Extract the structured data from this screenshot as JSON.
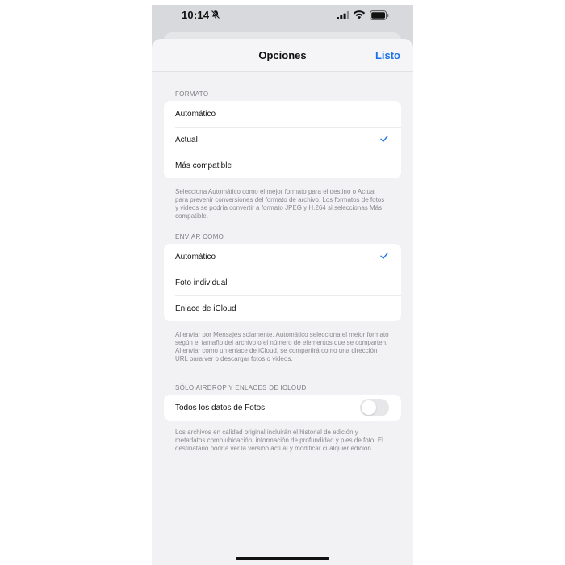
{
  "status_bar": {
    "time": "10:14",
    "silent_icon": "bell-slash-icon",
    "signal_icon": "cellular-signal-icon",
    "wifi_icon": "wifi-icon",
    "battery_icon": "battery-icon"
  },
  "header": {
    "title": "Opciones",
    "done_label": "Listo"
  },
  "format_section": {
    "title": "FORMATO",
    "options": [
      {
        "label": "Automático",
        "selected": false
      },
      {
        "label": "Actual",
        "selected": true
      },
      {
        "label": "Más compatible",
        "selected": false
      }
    ],
    "footnote": "Selecciona Automático como el mejor formato para el destino o Actual para prevenir conversiones del formato de archivo. Los formatos de fotos y videos se podría convertir a formato JPEG y H.264 si seleccionas Más compatible."
  },
  "send_as_section": {
    "title": "ENVIAR COMO",
    "options": [
      {
        "label": "Automático",
        "selected": true
      },
      {
        "label": "Foto individual",
        "selected": false
      },
      {
        "label": "Enlace de iCloud",
        "selected": false
      }
    ],
    "footnote": "Al enviar por Mensajes solamente, Automático selecciona el mejor formato según el tamaño del archivo o el número de elementos que se comparten. Al enviar como un enlace de iCloud, se compartirá como una dirección URL para ver o descargar fotos o videos."
  },
  "airdrop_section": {
    "title": "SÓLO AIRDROP Y ENLACES DE ICLOUD",
    "toggle_label": "Todos los datos de Fotos",
    "toggle_on": false,
    "footnote": "Los archivos en calidad original incluirán el historial de edición y metadatos como ubicación, información de profundidad y pies de foto. El destinatario podría ver la versión actual y modificar cualquier edición."
  },
  "colors": {
    "accent": "#1a73e8",
    "background": "#f2f2f4",
    "card": "#ffffff"
  }
}
